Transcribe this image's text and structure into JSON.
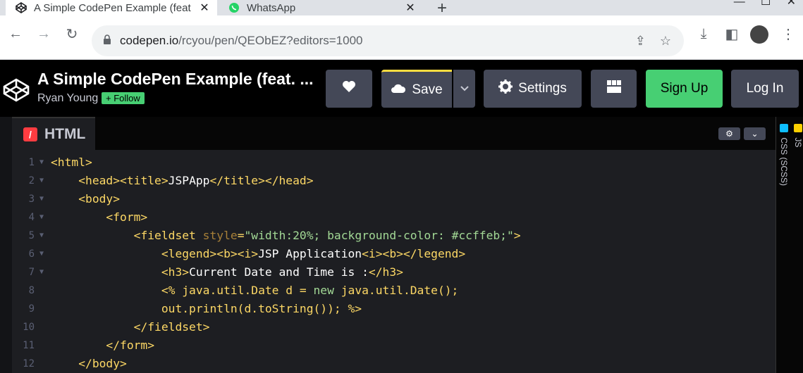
{
  "browser": {
    "tabs": [
      {
        "title": "A Simple CodePen Example (feat",
        "icon": "codepen-icon"
      },
      {
        "title": "WhatsApp",
        "icon": "whatsapp-icon"
      }
    ],
    "url_host": "codepen.io",
    "url_path": "/rcyou/pen/QEObEZ?editors=1000"
  },
  "pen": {
    "title": "A Simple CodePen Example (feat. ...",
    "author": "Ryan Young",
    "follow_label": "+ Follow"
  },
  "buttons": {
    "save": "Save",
    "settings": "Settings",
    "signup": "Sign Up",
    "login": "Log In"
  },
  "editor": {
    "tab_label": "HTML",
    "css_label": "CSS (SCSS)",
    "js_label": "JS",
    "line_numbers": [
      "1",
      "2",
      "3",
      "4",
      "5",
      "6",
      "7",
      "8",
      "9",
      "10",
      "11",
      "12"
    ]
  },
  "colors": {
    "accent_green": "#47cf73",
    "save_bar": "#ffdd40",
    "html_red": "#ff3c41"
  }
}
